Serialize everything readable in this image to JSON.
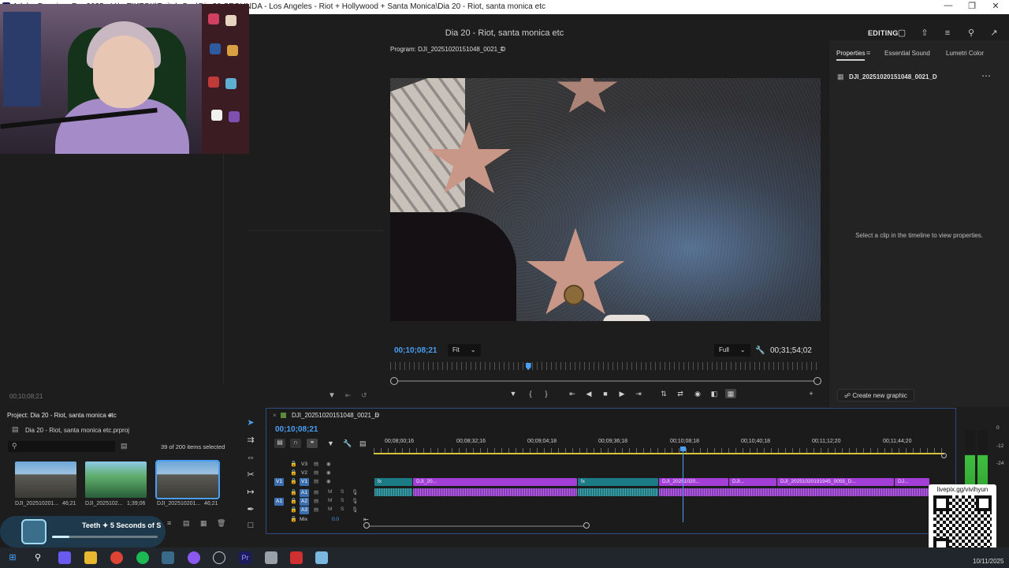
{
  "window": {
    "title": "Adobe Premiere Pro 2025 - V:\\+ TIKTOK\\Twitch Con\\Dia 20 SEGUNDA - Los Angeles - Riot + Hollywood + Santa Monica\\Dia 20 - Riot, santa monica etc"
  },
  "header": {
    "project_title": "Dia 20 - Riot, santa monica etc",
    "workspace_label": "EDITING"
  },
  "left_panel": {
    "timecode": "00;10;08;21"
  },
  "program_monitor": {
    "title": "Program: DJI_20251020151048_0021_D",
    "current_timecode": "00;10;08;21",
    "fit_label": "Fit",
    "quality_label": "Full",
    "duration_timecode": "00;31;54;02",
    "playhead_fraction": 0.32
  },
  "properties_panel": {
    "tabs": [
      "Properties",
      "Essential Sound",
      "Lumetri Color"
    ],
    "active_tab": "Properties",
    "clip_name": "DJI_20251020151048_0021_D",
    "hint": "Select a clip in the timeline to view properties.",
    "create_graphic_label": "Create new graphic"
  },
  "project_panel": {
    "title": "Project: Dia 20 - Riot, santa monica etc",
    "file_name": "Dia 20 - Riot, santa monica etc.prproj",
    "selection_count": "39 of 200 items selected",
    "thumbnails": [
      {
        "label": "DJI_202510201...",
        "duration": "46;21"
      },
      {
        "label": "DJI_2025102...",
        "duration": "1;39;06"
      },
      {
        "label": "DJI_202510201...",
        "duration": "46;21"
      }
    ]
  },
  "notification": {
    "text": "Teeth ✦ 5 Seconds of S"
  },
  "timeline": {
    "sequence_name": "DJI_20251020151048_0021_D",
    "current_timecode": "00;10;08;21",
    "ruler_labels": [
      "00;08;00;16",
      "00;08;32;16",
      "00;09;04;18",
      "00;09;36;18",
      "00;10;08;18",
      "00;10;40;18",
      "00;11;12;20",
      "00;11;44;20"
    ],
    "video_tracks": [
      "V3",
      "V2",
      "V1"
    ],
    "audio_tracks": [
      "A1",
      "A2",
      "A3"
    ],
    "source_v1": "V1",
    "source_a1": "A1",
    "mix_label": "Mix",
    "mix_value": "0.0",
    "clips": [
      {
        "label": "fx",
        "color": "teal"
      },
      {
        "label": "DJI_20...",
        "color": "purple"
      },
      {
        "label": "fx",
        "color": "teal"
      },
      {
        "label": "DJI_20251020...",
        "color": "purple"
      },
      {
        "label": "DJI...",
        "color": "purple"
      },
      {
        "label": "DJI_20251020191945_0055_D...",
        "color": "purple"
      },
      {
        "label": "DJ...",
        "color": "purple"
      }
    ]
  },
  "audio_meter": {
    "labels": [
      "0",
      "-12",
      "-24"
    ]
  },
  "overlay": {
    "qr_text": "livepix.gg/vivihyun"
  },
  "taskbar": {
    "date": "10/11/2025"
  },
  "colors": {
    "accent": "#4a9ff5",
    "clip_purple": "#a33fd6",
    "clip_teal": "#1c7c86",
    "work_area": "#d6c53a"
  }
}
